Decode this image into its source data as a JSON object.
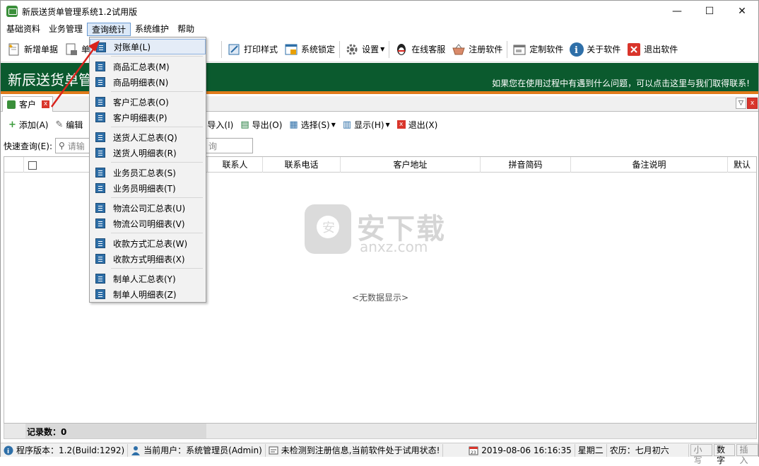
{
  "window": {
    "title": "新辰送货单管理系统1.2试用版",
    "min": "—",
    "max": "☐",
    "close": "✕"
  },
  "menu": [
    "基础资料",
    "业务管理",
    "查询统计",
    "系统维护",
    "帮助"
  ],
  "toolbar": [
    {
      "label": "新增单据",
      "icon": "new-doc-icon"
    },
    {
      "label": "单",
      "icon": "doc-lock-icon"
    },
    {
      "label": "打印样式",
      "icon": "print-style-icon"
    },
    {
      "label": "系统锁定",
      "icon": "lock-screen-icon"
    },
    {
      "label": "设置",
      "icon": "gear-icon"
    },
    {
      "label": "在线客服",
      "icon": "qq-icon"
    },
    {
      "label": "注册软件",
      "icon": "register-basket-icon"
    },
    {
      "label": "定制软件",
      "icon": "custom-window-icon"
    },
    {
      "label": "关于软件",
      "icon": "info-icon"
    },
    {
      "label": "退出软件",
      "icon": "exit-icon"
    }
  ],
  "banner": {
    "title": "新辰送货单管",
    "note": "如果您在使用过程中有遇到什么问题，可以点击这里与我们取得联系!"
  },
  "tab": {
    "label": "客户"
  },
  "subtoolbar": {
    "add": "添加(A)",
    "edit": "编辑",
    "import": "导入(I)",
    "export": "导出(O)",
    "select": "选择(S)",
    "display": "显示(H)",
    "quit": "退出(X)"
  },
  "search": {
    "label": "快速查询(E):",
    "placeholder": "请输",
    "suffix": "询"
  },
  "grid": {
    "columns": [
      "联系人",
      "联系电话",
      "客户地址",
      "拼音简码",
      "备注说明",
      "默认"
    ],
    "empty": "<无数据显示>"
  },
  "watermark": {
    "cn": "安下载",
    "en": "anxz.com"
  },
  "footer": {
    "records": "记录数：0"
  },
  "status": {
    "version": "程序版本：1.2(Build:1292)",
    "user": "当前用户：系统管理员(Admin)",
    "reg": "未检测到注册信息,当前软件处于试用状态!",
    "datetime": "2019-08-06 16:16:35",
    "weekday": "星期二",
    "lunar": "农历：七月初六",
    "keys": [
      "小写",
      "数字",
      "插入"
    ]
  },
  "dropdown": {
    "groups": [
      [
        "对账单(L)"
      ],
      [
        "商品汇总表(M)",
        "商品明细表(N)"
      ],
      [
        "客户汇总表(O)",
        "客户明细表(P)"
      ],
      [
        "送货人汇总表(Q)",
        "送货人明细表(R)"
      ],
      [
        "业务员汇总表(S)",
        "业务员明细表(T)"
      ],
      [
        "物流公司汇总表(U)",
        "物流公司明细表(V)"
      ],
      [
        "收款方式汇总表(W)",
        "收款方式明细表(X)"
      ],
      [
        "制单人汇总表(Y)",
        "制单人明细表(Z)"
      ]
    ]
  },
  "colors": {
    "banner": "#0b5a2e",
    "banner_border": "#e07a1a",
    "accent": "#2e6fa8",
    "arrow": "#d9231c"
  }
}
